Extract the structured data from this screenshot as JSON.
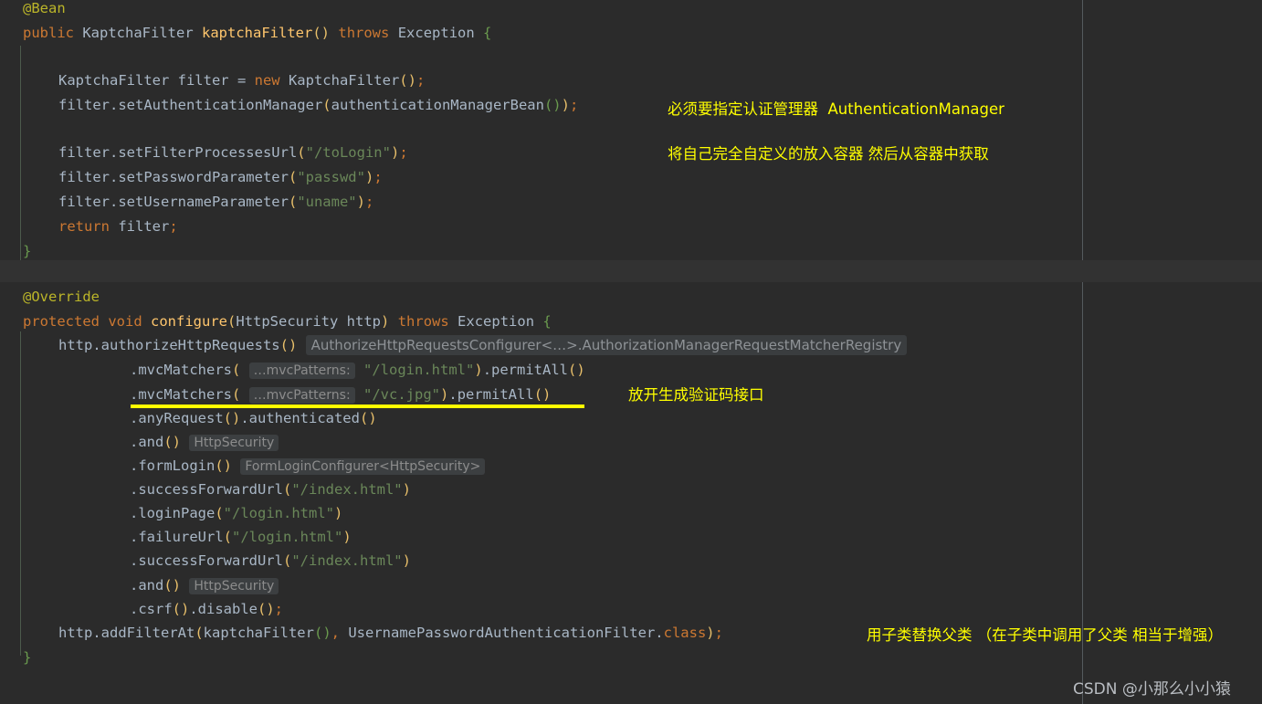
{
  "editor": {
    "background": "#2b2b2b",
    "foreground": "#a9b7c6",
    "annotation_color": "#ffff00",
    "hint_background": "#3c3f41",
    "hint_foreground": "#8c8c8c"
  },
  "code": {
    "block1": {
      "l1_annotation": "@Bean",
      "l2_kw_public": "public",
      "l2_type": "KaptchaFilter",
      "l2_fn": "kaptchaFilter",
      "l2_paren": "()",
      "l2_kw_throws": "throws",
      "l2_exception": "Exception",
      "l2_brace": "{",
      "l4_a": "KaptchaFilter filter = ",
      "l4_kw_new": "new",
      "l4_b": " KaptchaFilter",
      "l4_paren": "()",
      "l4_semi": ";",
      "l5_a": "filter.setAuthenticationManager",
      "l5_open": "(",
      "l5_b": "authenticationManagerBean",
      "l5_inner": "()",
      "l5_close": ")",
      "l5_semi": ";",
      "l7_a": "filter.setFilterProcessesUrl",
      "l7_open": "(",
      "l7_str": "\"/toLogin\"",
      "l7_close": ")",
      "l7_semi": ";",
      "l8_a": "filter.setPasswordParameter",
      "l8_open": "(",
      "l8_str": "\"passwd\"",
      "l8_close": ")",
      "l8_semi": ";",
      "l9_a": "filter.setUsernameParameter",
      "l9_open": "(",
      "l9_str": "\"uname\"",
      "l9_close": ")",
      "l9_semi": ";",
      "l10_kw_return": "return",
      "l10_var": " filter",
      "l10_semi": ";",
      "l11_brace": "}"
    },
    "block2": {
      "l1_annotation": "@Override",
      "l2_kw_protected": "protected",
      "l2_kw_void": "void",
      "l2_fn": "configure",
      "l2_open": "(",
      "l2_type": "HttpSecurity",
      "l2_param": " http",
      "l2_close": ")",
      "l2_kw_throws": "throws",
      "l2_exception": "Exception",
      "l2_brace": "{",
      "l3_a": "http.authorizeHttpRequests",
      "l3_paren": "()",
      "l3_hint": "AuthorizeHttpRequestsConfigurer<…>.AuthorizationManagerRequestMatcherRegistry",
      "l4_a": ".mvcMatchers",
      "l4_open": "(",
      "l4_hint": "…mvcPatterns:",
      "l4_str": "\"/login.html\"",
      "l4_close": ")",
      "l4_b": ".permitAll",
      "l4_paren2": "()",
      "l5_a": ".mvcMatchers",
      "l5_open": "(",
      "l5_hint": "…mvcPatterns:",
      "l5_str": "\"/vc.jpg\"",
      "l5_close": ")",
      "l5_b": ".permitAll",
      "l5_paren2": "()",
      "l6_a": ".anyRequest",
      "l6_paren": "()",
      "l6_b": ".authenticated",
      "l6_paren2": "()",
      "l7_a": ".and",
      "l7_paren": "()",
      "l7_hint": "HttpSecurity",
      "l8_a": ".formLogin",
      "l8_paren": "()",
      "l8_hint": "FormLoginConfigurer<HttpSecurity>",
      "l9_a": ".successForwardUrl",
      "l9_open": "(",
      "l9_str": "\"/index.html\"",
      "l9_close": ")",
      "l10_a": ".loginPage",
      "l10_open": "(",
      "l10_str": "\"/login.html\"",
      "l10_close": ")",
      "l11_a": ".failureUrl",
      "l11_open": "(",
      "l11_str": "\"/login.html\"",
      "l11_close": ")",
      "l12_a": ".successForwardUrl",
      "l12_open": "(",
      "l12_str": "\"/index.html\"",
      "l12_close": ")",
      "l13_a": ".and",
      "l13_paren": "()",
      "l13_hint": "HttpSecurity",
      "l14_a": ".csrf",
      "l14_paren": "()",
      "l14_b": ".disable",
      "l14_paren2": "()",
      "l14_semi": ";",
      "l15_a": "http.addFilterAt",
      "l15_open": "(",
      "l15_b": "kaptchaFilter",
      "l15_paren": "()",
      "l15_comma": ", ",
      "l15_type": "UsernamePasswordAuthenticationFilter",
      "l15_dot": ".",
      "l15_kw_class": "class",
      "l15_close": ")",
      "l15_semi": ";",
      "l16_brace": "}"
    }
  },
  "annotations": [
    {
      "text": "必须要指定认证管理器  AuthenticationManager"
    },
    {
      "text": "将自己完全自定义的放入容器 然后从容器中获取"
    },
    {
      "text": "放开生成验证码接口"
    },
    {
      "text": "用子类替换父类 （在子类中调用了父类 相当于增强）"
    }
  ],
  "watermark": {
    "text": "CSDN @小那么小小猿"
  }
}
